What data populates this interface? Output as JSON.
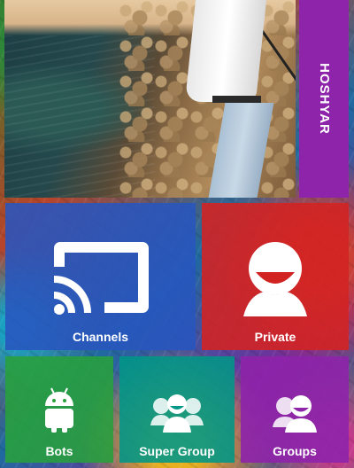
{
  "header": {
    "banner_title": "HOSHYAR"
  },
  "tiles": {
    "channels": {
      "label": "Channels",
      "icon": "cast-icon",
      "color": "#2855be"
    },
    "private": {
      "label": "Private",
      "icon": "user-icon",
      "color": "#d22323"
    },
    "bots": {
      "label": "Bots",
      "icon": "android-icon",
      "color": "#28a03c"
    },
    "supergroup": {
      "label": "Super Group",
      "icon": "people-group-icon",
      "color": "#009688"
    },
    "groups": {
      "label": "Groups",
      "icon": "people-icon",
      "color": "#8e24aa"
    }
  }
}
